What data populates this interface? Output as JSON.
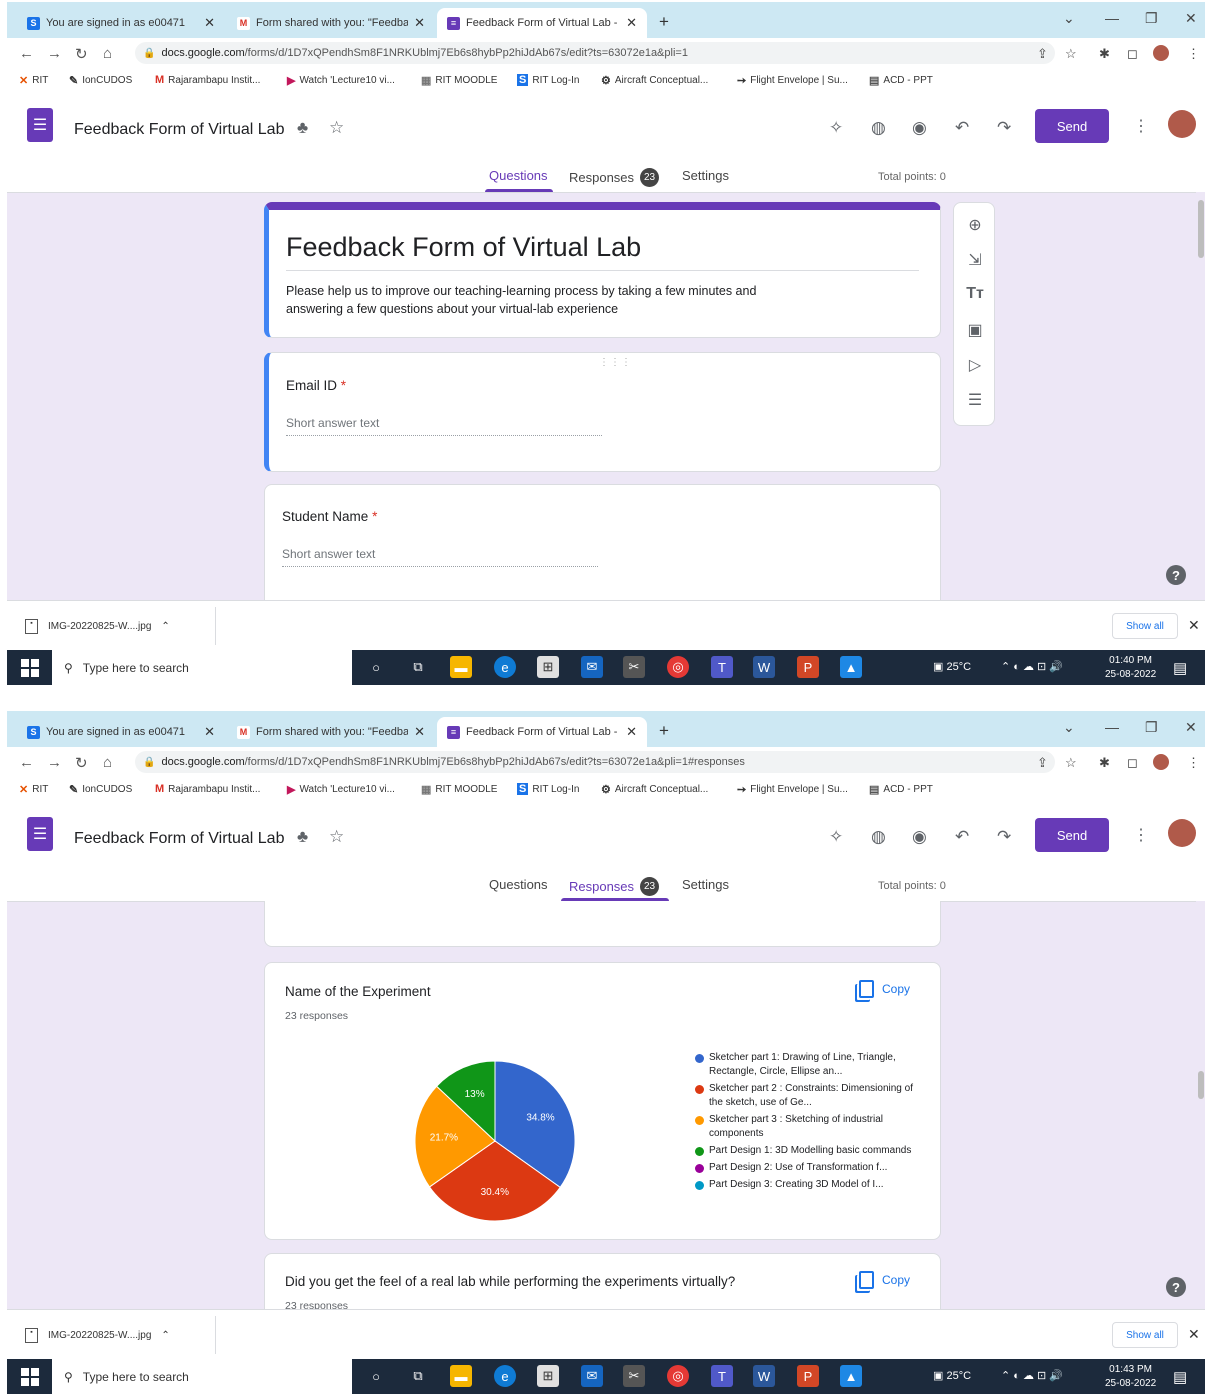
{
  "browser": {
    "tabs": [
      {
        "title": "You are signed in as e00471",
        "icon": "s-icon",
        "color": "#1a73e8"
      },
      {
        "title": "Form shared with you: \"Feedback",
        "icon": "gmail-icon",
        "color": "#d93025"
      },
      {
        "title": "Feedback Form of Virtual Lab - G",
        "icon": "forms-icon",
        "color": "#673ab7"
      }
    ],
    "new_tab": "+",
    "url_host": "docs.google.com",
    "url_path_1": "/forms/d/1D7xQPendhSm8F1NRKUblmj7Eb6s8hybPp2hiJdAb67s/edit?ts=63072e1a&pli=1",
    "url_path_2": "/forms/d/1D7xQPendhSm8F1NRKUblmj7Eb6s8hybPp2hiJdAb67s/edit?ts=63072e1a&pli=1#responses",
    "bookmarks": [
      "RIT",
      "IonCUDOS",
      "Rajarambapu Instit...",
      "Watch 'Lecture10 vi...",
      "RIT MOODLE",
      "RIT Log-In",
      "Aircraft Conceptual...",
      "Flight Envelope | Su...",
      "ACD - PPT"
    ]
  },
  "form": {
    "title": "Feedback Form of Virtual Lab",
    "send_label": "Send",
    "tabs": {
      "questions": "Questions",
      "responses": "Responses",
      "responses_count": "23",
      "settings": "Settings"
    },
    "total_points": "Total points: 0",
    "heading": "Feedback Form of Virtual Lab",
    "description": "Please help us to improve our teaching-learning process by taking a few minutes and answering a few questions about your virtual-lab experience",
    "questions": [
      {
        "label": "Email ID",
        "required": "*",
        "answer": "Short answer text"
      },
      {
        "label": "Student Name",
        "required": "*",
        "answer": "Short answer text"
      }
    ],
    "toolbox": [
      "add-question-icon",
      "import-questions-icon",
      "add-title-icon",
      "add-image-icon",
      "add-video-icon",
      "add-section-icon"
    ]
  },
  "responses": {
    "card1": {
      "title": "Name of the Experiment",
      "count": "23 responses",
      "copy": "Copy"
    },
    "card2": {
      "title": "Did you get the feel of a real lab while performing the experiments virtually?",
      "count": "23 responses",
      "copy": "Copy"
    },
    "legend": [
      {
        "label": "Sketcher part 1: Drawing of Line, Triangle, Rectangle, Circle, Ellipse an...",
        "color": "#3366cc"
      },
      {
        "label": "Sketcher part 2 : Constraints: Dimensioning of the sketch, use of Ge...",
        "color": "#dc3912"
      },
      {
        "label": "Sketcher part 3 : Sketching of industrial components",
        "color": "#ff9900"
      },
      {
        "label": "Part Design 1: 3D Modelling basic commands",
        "color": "#109618"
      },
      {
        "label": "Part Design 2: Use of Transformation f...",
        "color": "#990099"
      },
      {
        "label": "Part Design 3: Creating 3D Model of I...",
        "color": "#0099c6"
      }
    ]
  },
  "chart_data": {
    "type": "pie",
    "title": "Name of the Experiment",
    "categories": [
      "Sketcher part 1: Drawing of Line, Triangle, Rectangle, Circle, Ellipse an...",
      "Sketcher part 2 : Constraints: Dimensioning of the sketch, use of Ge...",
      "Sketcher part 3 : Sketching of industrial components",
      "Part Design 1: 3D Modelling basic commands",
      "Part Design 2: Use of Transformation f...",
      "Part Design 3: Creating 3D Model of I..."
    ],
    "values": [
      34.8,
      30.4,
      21.7,
      13,
      0,
      0
    ],
    "value_labels": [
      "34.8%",
      "30.4%",
      "21.7%",
      "13%",
      "",
      ""
    ],
    "colors": [
      "#3366cc",
      "#dc3912",
      "#ff9900",
      "#109618",
      "#990099",
      "#0099c6"
    ],
    "legend_position": "right"
  },
  "downloads": {
    "file": "IMG-20220825-W....jpg",
    "show_all": "Show all"
  },
  "taskbar": {
    "search_placeholder": "Type here to search",
    "temperature": "25°C",
    "time_1": "01:40 PM",
    "time_2": "01:43 PM",
    "date": "25-08-2022"
  }
}
